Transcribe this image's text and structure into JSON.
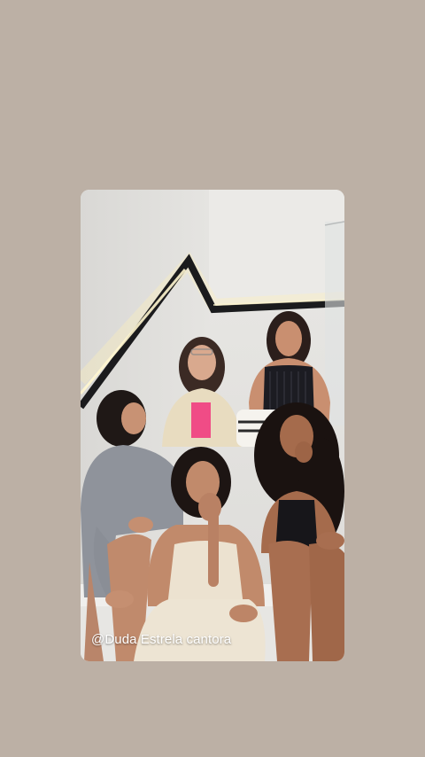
{
  "story": {
    "caption": "@Duda Estrela cantora"
  },
  "colors": {
    "background": "#bcb0a5",
    "caption_text": "#ffffff"
  }
}
